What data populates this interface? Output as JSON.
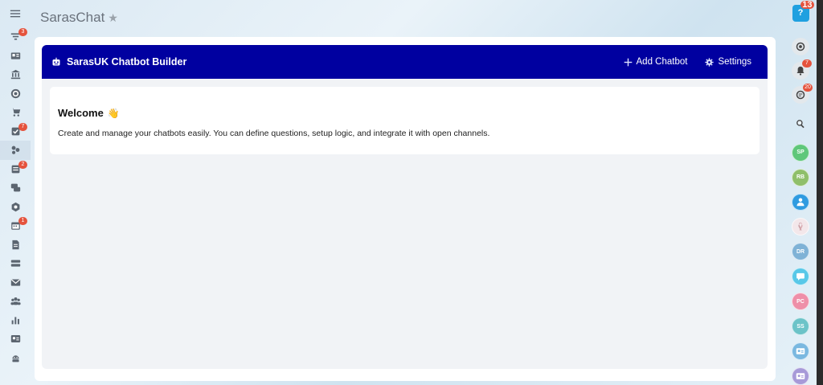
{
  "app": {
    "title": "SarasChat"
  },
  "left_sidebar": {
    "badges": {
      "filters": "3",
      "tasks": "7",
      "inbox": "2",
      "calendar": "1"
    }
  },
  "builder": {
    "title": "SarasUK Chatbot Builder",
    "add_label": "Add Chatbot",
    "settings_label": "Settings"
  },
  "welcome": {
    "title": "Welcome",
    "emoji": "👋",
    "text": "Create and manage your chatbots easily. You can define questions, setup logic, and integrate it with open channels."
  },
  "right_sidebar": {
    "help_badge": "13",
    "notifications_badge": "7",
    "chats_badge": "20",
    "avatars": [
      {
        "initials": "SP",
        "color": "#5fc77a"
      },
      {
        "initials": "RB",
        "color": "#8fbf6a"
      },
      {
        "initials": "DR",
        "color": "#7fb2d6"
      },
      {
        "initials": "PC",
        "color": "#ee8fa8"
      },
      {
        "initials": "SS",
        "color": "#6cc3c8"
      }
    ]
  },
  "colors": {
    "header": "#0000a0",
    "badge": "#e5533d",
    "help": "#1fa0e0"
  }
}
